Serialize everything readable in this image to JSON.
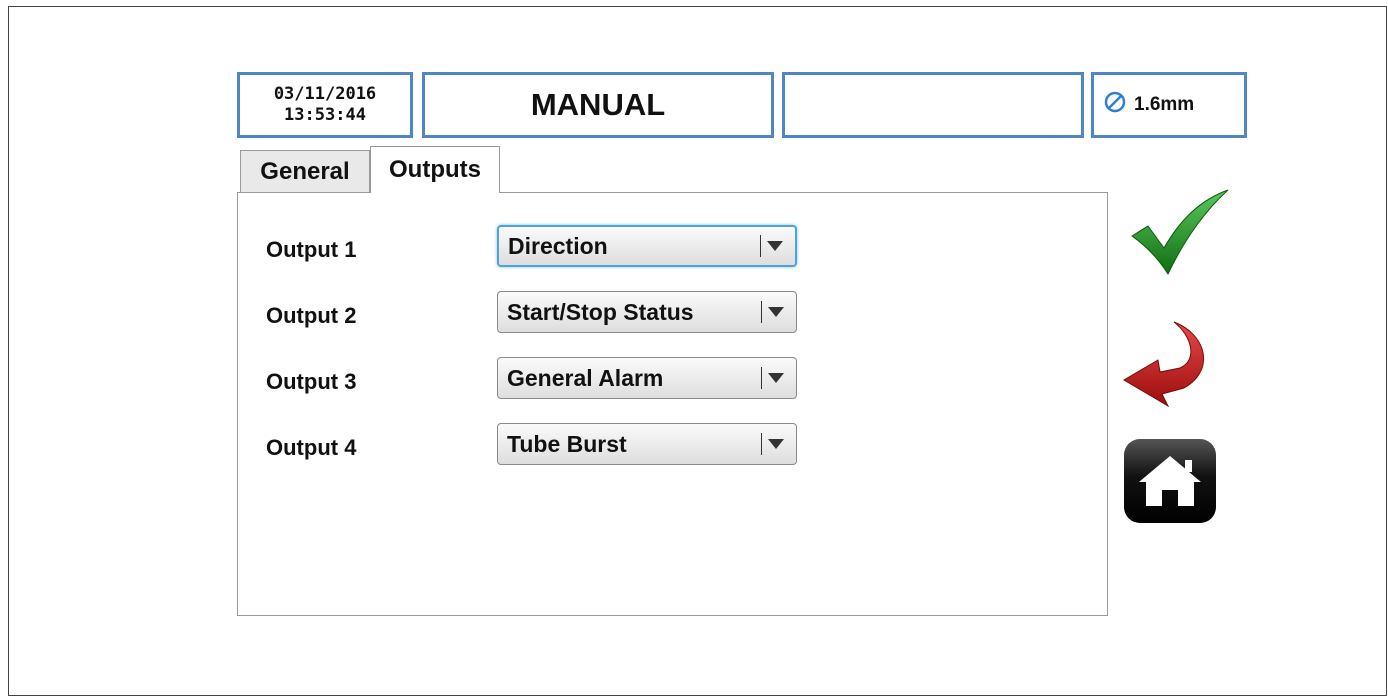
{
  "header": {
    "date": "03/11/2016",
    "time": "13:53:44",
    "mode": "MANUAL",
    "status": "",
    "tube_size": "1.6mm",
    "tube_icon": "diameter-icon"
  },
  "tabs": [
    {
      "label": "General",
      "active": false
    },
    {
      "label": "Outputs",
      "active": true
    }
  ],
  "outputs": [
    {
      "label": "Output 1",
      "value": "Direction"
    },
    {
      "label": "Output 2",
      "value": "Start/Stop Status"
    },
    {
      "label": "Output 3",
      "value": "General Alarm"
    },
    {
      "label": "Output 4",
      "value": "Tube Burst"
    }
  ],
  "actions": [
    {
      "name": "confirm",
      "icon": "checkmark-icon",
      "color": "#1e8a1e"
    },
    {
      "name": "back",
      "icon": "back-arrow-icon",
      "color": "#c01818"
    },
    {
      "name": "home",
      "icon": "home-icon",
      "color": "#111111"
    }
  ]
}
